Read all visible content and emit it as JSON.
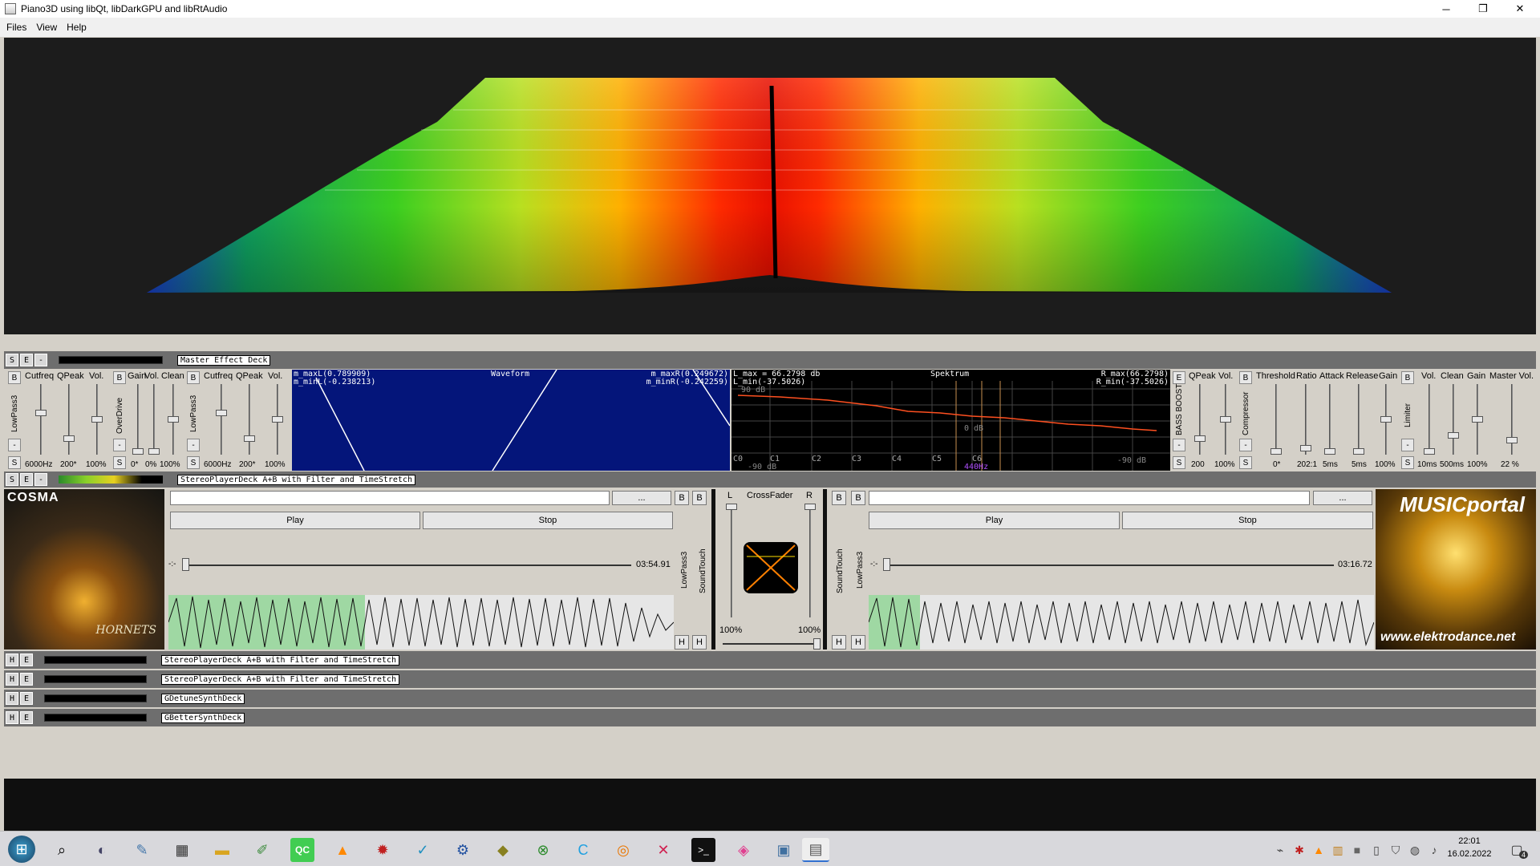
{
  "window": {
    "title": "Piano3D using libQt, libDarkGPU and libRtAudio",
    "minimize": "─",
    "maximize": "❐",
    "close": "✕"
  },
  "menu": [
    "Files",
    "View",
    "Help"
  ],
  "master_deck": {
    "buttons": [
      "S",
      "E",
      "-"
    ],
    "label": "Master Effect Deck"
  },
  "effects": {
    "lowpass1": {
      "toggle": "B",
      "title": "LowPass3",
      "headers": [
        "Cutfreq",
        "QPeak",
        "Vol."
      ],
      "values": [
        "6000Hz",
        "200*",
        "100%"
      ],
      "minus": "-",
      "solo": "S"
    },
    "overdrive": {
      "toggle": "B",
      "title": "OverDrive",
      "headers": [
        "Gain",
        "Vol.",
        "Clean"
      ],
      "values": [
        "0*",
        "0%",
        "100%"
      ],
      "minus": "-",
      "solo": "S"
    },
    "lowpass2": {
      "toggle": "B",
      "title": "LowPass3",
      "headers": [
        "Cutfreq",
        "QPeak",
        "Vol."
      ],
      "values": [
        "6000Hz",
        "200*",
        "100%"
      ],
      "minus": "-",
      "solo": "S"
    },
    "waveform": {
      "title": "Waveform",
      "max_l": "m_maxL(0.789909)",
      "min_l": "m_minL(-0.238213)",
      "max_r": "m_maxR(0.249672)",
      "min_r": "m_minR(-0.242259)"
    },
    "spektrum": {
      "title": "Spektrum",
      "l_max": "L_max = 66.2798 db",
      "l_min": "L_min(-37.5026)",
      "r_max": "R_max(66.2798)",
      "r_min": "R_min(-37.5026)",
      "db_top": "90 dB",
      "db_mid": "0 dB",
      "db_low": "-90 dB",
      "db_low_left": "-90 dB",
      "notes": [
        "C0",
        "C1",
        "C2",
        "C3",
        "C4",
        "C5",
        "C6"
      ],
      "freq_mark": "440Hz"
    },
    "bassboost": {
      "toggle": "E",
      "title": "BASS BOOST",
      "headers": [
        "QPeak",
        "Vol."
      ],
      "values": [
        "200",
        "100%"
      ],
      "minus": "-",
      "solo": "S"
    },
    "compressor": {
      "toggle": "B",
      "title": "Compressor",
      "headers": [
        "Threshold",
        "Ratio",
        "Attack",
        "Release",
        "Gain"
      ],
      "values": [
        "0*",
        "202:1",
        "5ms",
        "5ms",
        "100%"
      ],
      "minus": "-",
      "solo": "S"
    },
    "limiter": {
      "toggle": "B",
      "title": "Limiter",
      "headers": [
        "Vol.",
        "Clean",
        "Gain",
        "Master Vol."
      ],
      "values": [
        "10ms",
        "500ms",
        "100%",
        "22 %"
      ],
      "minus": "-",
      "solo": "S"
    }
  },
  "player_deck": {
    "buttons": [
      "S",
      "E",
      "-"
    ],
    "label": "StereoPlayerDeck A+B with Filter and TimeStretch"
  },
  "deck_a": {
    "cover_text": "COSMA",
    "cover_sub": "HORNETS",
    "browse": "...",
    "b1": "B",
    "b2": "B",
    "play": "Play",
    "stop": "Stop",
    "position": "-:-",
    "duration": "03:54.91",
    "fx1": "LowPass3",
    "fx2": "SoundTouch",
    "h1": "H",
    "h2": "H"
  },
  "crossfader": {
    "title": "CrossFader",
    "left": "L",
    "right": "R",
    "left_vol": "100%",
    "right_vol": "100%"
  },
  "deck_b": {
    "cover_title": "MUSICportal",
    "cover_url": "www.elektrodance.net",
    "browse": "...",
    "b1": "B",
    "b2": "B",
    "play": "Play",
    "stop": "Stop",
    "position": "-:-",
    "duration": "03:16.72",
    "fx1": "SoundTouch",
    "fx2": "LowPass3",
    "h1": "H",
    "h2": "H"
  },
  "collapsed_decks": [
    {
      "h": "H",
      "e": "E",
      "label": "StereoPlayerDeck A+B with Filter and TimeStretch"
    },
    {
      "h": "H",
      "e": "E",
      "label": "StereoPlayerDeck A+B with Filter and TimeStretch"
    },
    {
      "h": "H",
      "e": "E",
      "label": "GDetuneSynthDeck"
    },
    {
      "h": "H",
      "e": "E",
      "label": "GBetterSynthDeck"
    }
  ],
  "taskbar": {
    "time": "22:01",
    "date": "16.02.2022",
    "notifications": "4"
  },
  "colors": {
    "accent_green": "#9fd8a3",
    "waveform_bg": "#04157a",
    "spectrum_line": "#ff5020"
  }
}
